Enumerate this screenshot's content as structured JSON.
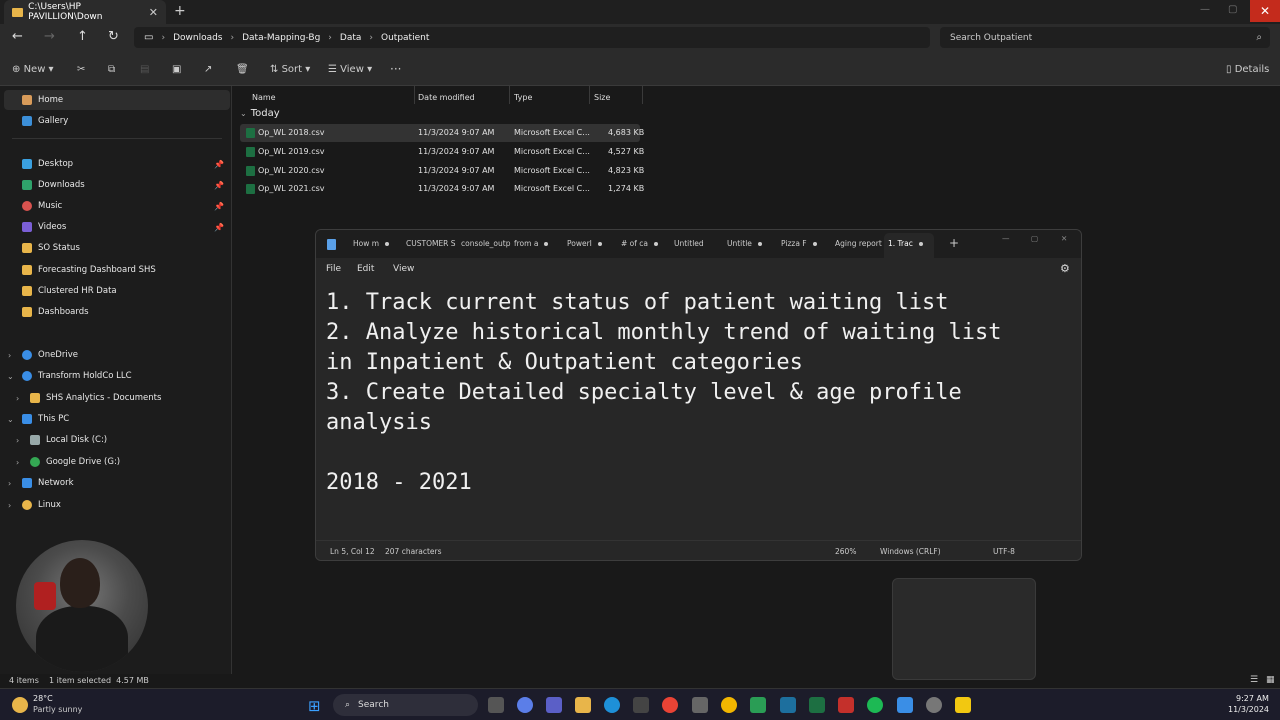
{
  "explorer": {
    "tab_title": "C:\\Users\\HP PAVILLION\\Down",
    "breadcrumb": [
      "Downloads",
      "Data-Mapping-Bg",
      "Data",
      "Outpatient"
    ],
    "search_placeholder": "Search Outpatient",
    "toolbar": {
      "new": "New",
      "sort": "Sort",
      "view": "View",
      "more": "···",
      "details": "Details"
    },
    "sidebar": {
      "home": "Home",
      "gallery": "Gallery",
      "pinned": [
        "Desktop",
        "Downloads",
        "Music",
        "Videos"
      ],
      "folders": [
        "SO Status",
        "Forecasting Dashboard SHS",
        "Clustered HR Data",
        "Dashboards"
      ],
      "onedrive": "OneDrive",
      "transform": "Transform HoldCo LLC",
      "shs": "SHS Analytics - Documents",
      "thispc": "This PC",
      "localdisk": "Local Disk (C:)",
      "gdrive": "Google Drive (G:)",
      "network": "Network",
      "linux": "Linux"
    },
    "columns": {
      "name": "Name",
      "date": "Date modified",
      "type": "Type",
      "size": "Size"
    },
    "group": "Today",
    "files": [
      {
        "name": "Op_WL 2018.csv",
        "date": "11/3/2024 9:07 AM",
        "type": "Microsoft Excel C...",
        "size": "4,683 KB"
      },
      {
        "name": "Op_WL 2019.csv",
        "date": "11/3/2024 9:07 AM",
        "type": "Microsoft Excel C...",
        "size": "4,527 KB"
      },
      {
        "name": "Op_WL 2020.csv",
        "date": "11/3/2024 9:07 AM",
        "type": "Microsoft Excel C...",
        "size": "4,823 KB"
      },
      {
        "name": "Op_WL 2021.csv",
        "date": "11/3/2024 9:07 AM",
        "type": "Microsoft Excel C...",
        "size": "1,274 KB"
      }
    ],
    "status": {
      "items": "4 items",
      "selected": "1 item selected  4.57 MB"
    }
  },
  "notepad": {
    "tabs": [
      "How m",
      "CUSTOMER S",
      "console_outp",
      "from a",
      "PowerI",
      "# of ca",
      "Untitled",
      "Untitle",
      "Pizza F",
      "Aging report",
      "1. Trac"
    ],
    "menu": {
      "file": "File",
      "edit": "Edit",
      "view": "View"
    },
    "content": "1. Track current status of patient waiting list\n2. Analyze historical monthly trend of waiting list\nin Inpatient & Outpatient categories\n3. Create Detailed specialty level & age profile\nanalysis\n\n2018 - 2021",
    "status": {
      "pos": "Ln 5, Col 12",
      "chars": "207 characters",
      "zoom": "260%",
      "eol": "Windows (CRLF)",
      "enc": "UTF-8"
    }
  },
  "taskbar": {
    "weather_temp": "28°C",
    "weather_desc": "Partly sunny",
    "search": "Search",
    "time": "9:27 AM",
    "date": "11/3/2024"
  }
}
